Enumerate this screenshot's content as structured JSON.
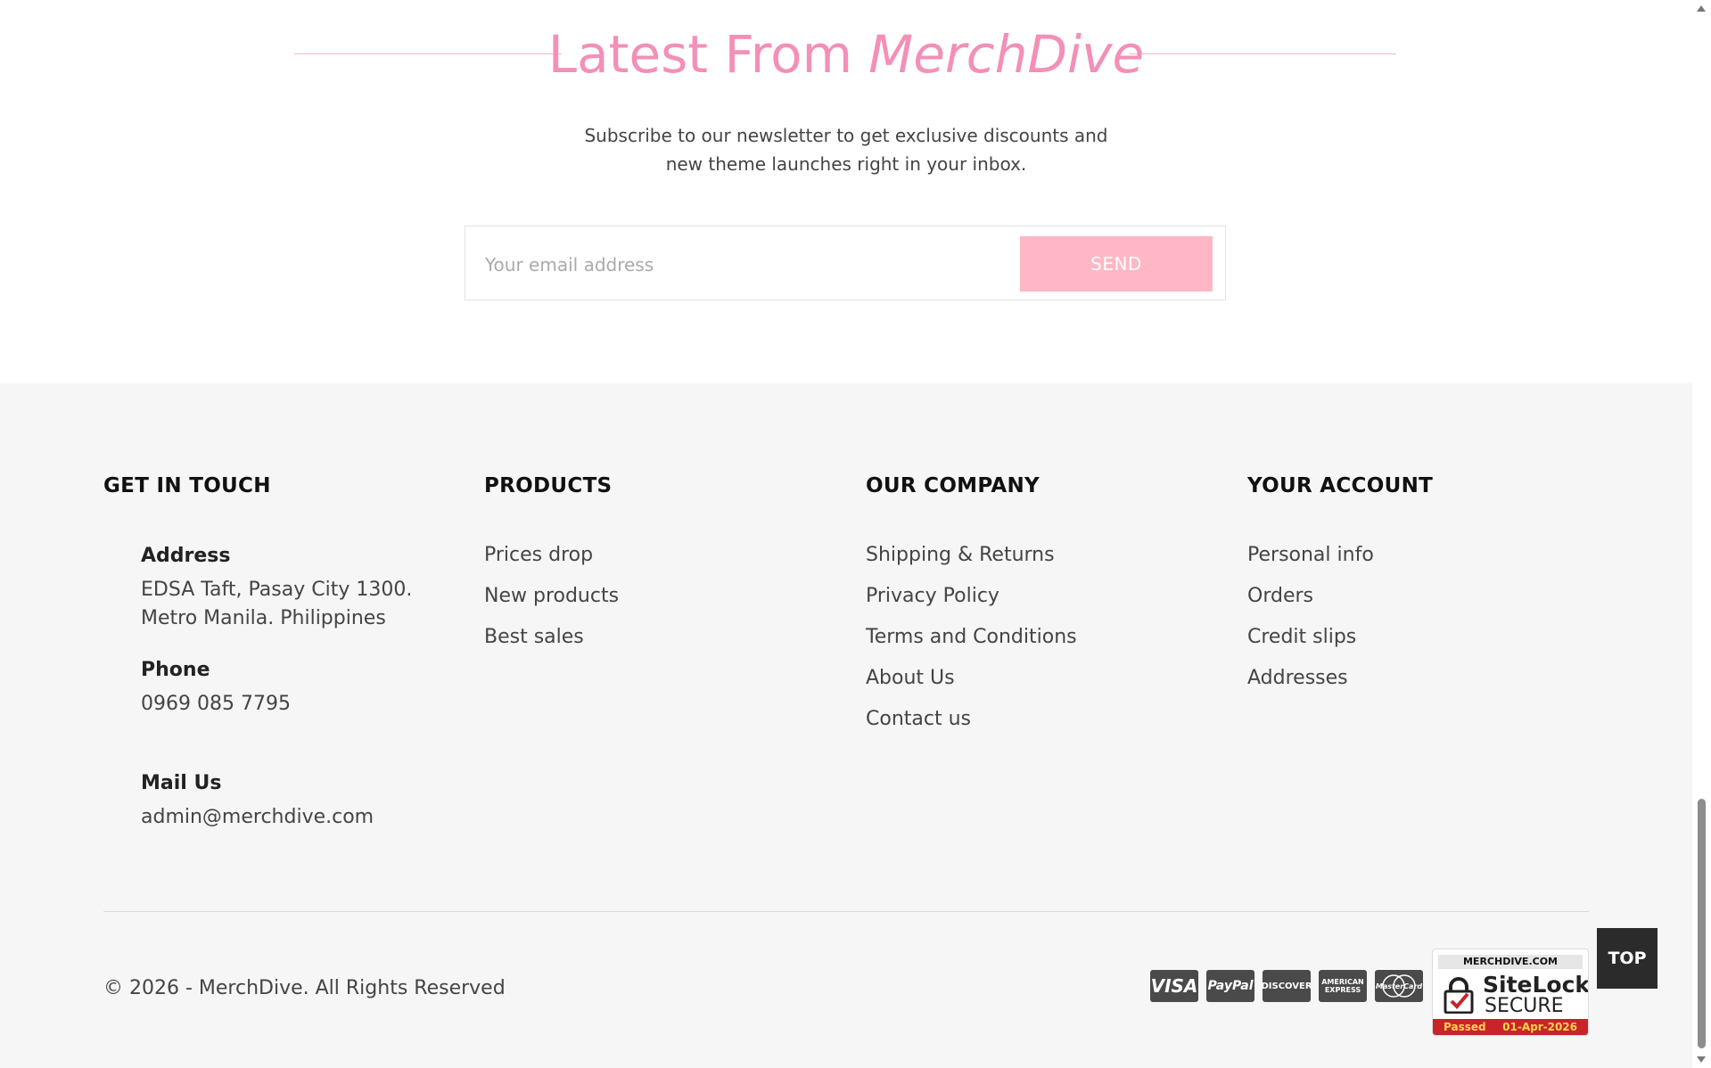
{
  "newsletter": {
    "title_prefix": "Latest From",
    "title_brand": "MerchDive",
    "subtitle_line1": "Subscribe to our newsletter to get exclusive discounts and",
    "subtitle_line2": "new theme launches right in your inbox.",
    "email_placeholder": "Your email address",
    "send_label": "SEND"
  },
  "footer": {
    "get_in_touch": {
      "heading": "GET IN TOUCH",
      "address_label": "Address",
      "address_line1": "EDSA Taft, Pasay City 1300.",
      "address_line2": "Metro Manila. Philippines",
      "phone_label": "Phone",
      "phone_value": "0969 085 7795",
      "mail_label": "Mail Us",
      "mail_value": "admin@merchdive.com"
    },
    "products": {
      "heading": "PRODUCTS",
      "items": [
        "Prices drop",
        "New products",
        "Best sales"
      ]
    },
    "company": {
      "heading": "OUR COMPANY",
      "items": [
        "Shipping & Returns",
        "Privacy Policy",
        "Terms and Conditions",
        "About Us",
        "Contact us"
      ]
    },
    "account": {
      "heading": "YOUR ACCOUNT",
      "items": [
        "Personal info",
        "Orders",
        "Credit slips",
        "Addresses"
      ]
    },
    "copyright": "© 2026 - MerchDive. All Rights Reserved",
    "payments": [
      {
        "name": "visa",
        "label": "VISA"
      },
      {
        "name": "paypal",
        "label": "PayPal"
      },
      {
        "name": "discover",
        "label": "DISCOVER"
      },
      {
        "name": "amex",
        "label_line1": "AMERICAN",
        "label_line2": "EXPRESS"
      },
      {
        "name": "mastercard",
        "label": "MasterCard"
      }
    ],
    "sitelock": {
      "domain": "MERCHDIVE.COM",
      "name": "SiteLock",
      "secure": "SECURE",
      "passed": "Passed",
      "date": "01-Apr-2026"
    }
  },
  "top_button": "TOP",
  "colors": {
    "accent_pink": "#f38fb8",
    "send_button": "#ffb7c5",
    "footer_bg": "#f6f6f6",
    "top_button_bg": "#2b2b2b"
  }
}
